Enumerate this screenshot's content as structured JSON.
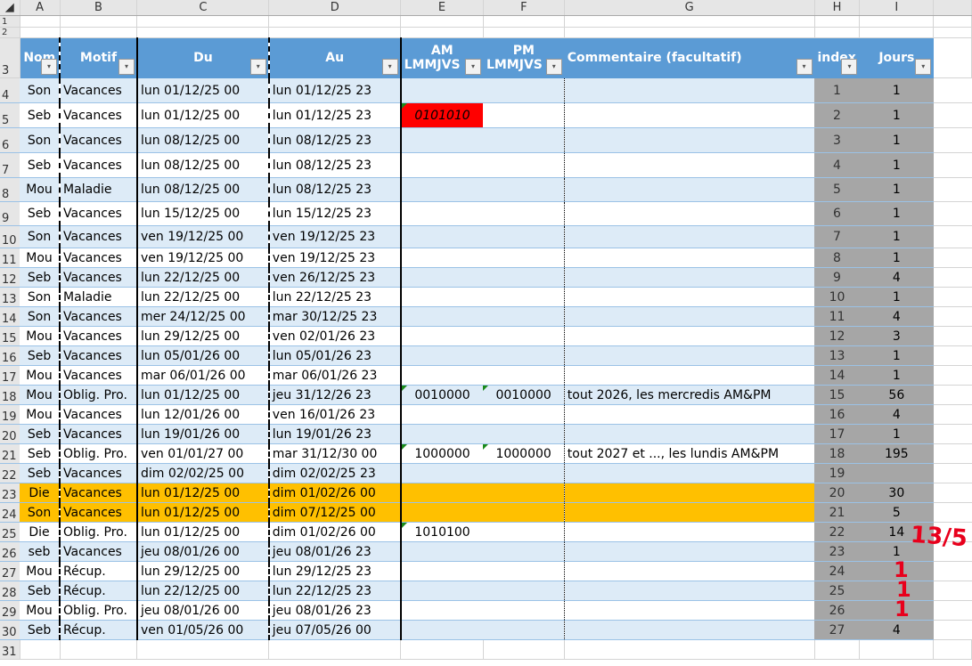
{
  "columns": [
    "A",
    "B",
    "C",
    "D",
    "E",
    "F",
    "G",
    "H",
    "I"
  ],
  "headers": {
    "nom": "Nom",
    "motif": "Motif",
    "du": "Du",
    "au": "Au",
    "am1": "AM",
    "am2": "LMMJVS",
    "pm1": "PM",
    "pm2": "LMMJVS",
    "commentaire": "Commentaire (facultatif)",
    "index": "index",
    "jours": "Jours"
  },
  "rows": [
    [
      "Son",
      "Vacances",
      "lun 01/12/25 00",
      "lun 01/12/25 23",
      "",
      "",
      "",
      "1",
      "1"
    ],
    [
      "Seb",
      "Vacances",
      "lun 01/12/25 00",
      "lun 01/12/25 23",
      "0101010",
      "",
      "",
      "2",
      "1"
    ],
    [
      "Son",
      "Vacances",
      "lun 08/12/25 00",
      "lun 08/12/25 23",
      "",
      "",
      "",
      "3",
      "1"
    ],
    [
      "Seb",
      "Vacances",
      "lun 08/12/25 00",
      "lun 08/12/25 23",
      "",
      "",
      "",
      "4",
      "1"
    ],
    [
      "Mou",
      "Maladie",
      "lun 08/12/25 00",
      "lun 08/12/25 23",
      "",
      "",
      "",
      "5",
      "1"
    ],
    [
      "Seb",
      "Vacances",
      "lun 15/12/25 00",
      "lun 15/12/25 23",
      "",
      "",
      "",
      "6",
      "1"
    ],
    [
      "Son",
      "Vacances",
      "ven 19/12/25 00",
      "ven 19/12/25 23",
      "",
      "",
      "",
      "7",
      "1"
    ],
    [
      "Mou",
      "Vacances",
      "ven 19/12/25 00",
      "ven 19/12/25 23",
      "",
      "",
      "",
      "8",
      "1"
    ],
    [
      "Seb",
      "Vacances",
      "lun 22/12/25 00",
      "ven 26/12/25 23",
      "",
      "",
      "",
      "9",
      "4"
    ],
    [
      "Son",
      "Maladie",
      "lun 22/12/25 00",
      "lun 22/12/25 23",
      "",
      "",
      "",
      "10",
      "1"
    ],
    [
      "Son",
      "Vacances",
      "mer 24/12/25 00",
      "mar 30/12/25 23",
      "",
      "",
      "",
      "11",
      "4"
    ],
    [
      "Mou",
      "Vacances",
      "lun 29/12/25 00",
      "ven 02/01/26 23",
      "",
      "",
      "",
      "12",
      "3"
    ],
    [
      "Seb",
      "Vacances",
      "lun 05/01/26 00",
      "lun 05/01/26 23",
      "",
      "",
      "",
      "13",
      "1"
    ],
    [
      "Mou",
      "Vacances",
      "mar 06/01/26 00",
      "mar 06/01/26 23",
      "",
      "",
      "",
      "14",
      "1"
    ],
    [
      "Mou",
      "Oblig. Pro.",
      "lun 01/12/25 00",
      "jeu 31/12/26 23",
      "0010000",
      "0010000",
      "tout 2026, les mercredis AM&PM",
      "15",
      "56"
    ],
    [
      "Mou",
      "Vacances",
      "lun 12/01/26 00",
      "ven 16/01/26 23",
      "",
      "",
      "",
      "16",
      "4"
    ],
    [
      "Seb",
      "Vacances",
      "lun 19/01/26 00",
      "lun 19/01/26 23",
      "",
      "",
      "",
      "17",
      "1"
    ],
    [
      "Seb",
      "Oblig. Pro.",
      "ven 01/01/27 00",
      "mar 31/12/30 00",
      "1000000",
      "1000000",
      "tout 2027 et ..., les lundis AM&PM",
      "18",
      "195"
    ],
    [
      "Seb",
      "Vacances",
      "dim 02/02/25 00",
      "dim 02/02/25 23",
      "",
      "",
      "",
      "19",
      ""
    ],
    [
      "Die",
      "Vacances",
      "lun 01/12/25 00",
      "dim 01/02/26 00",
      "",
      "",
      "",
      "20",
      "30"
    ],
    [
      "Son",
      "Vacances",
      "lun 01/12/25 00",
      "dim 07/12/25 00",
      "",
      "",
      "",
      "21",
      "5"
    ],
    [
      "Die",
      "Oblig. Pro.",
      "lun 01/12/25 00",
      "dim 01/02/26 00",
      "1010100",
      "",
      "",
      "22",
      "14"
    ],
    [
      "seb",
      "Vacances",
      "jeu 08/01/26 00",
      "jeu 08/01/26 23",
      "",
      "",
      "",
      "23",
      "1"
    ],
    [
      "Mou",
      "Récup.",
      "lun 29/12/25 00",
      "lun 29/12/25 23",
      "",
      "",
      "",
      "24",
      ""
    ],
    [
      "Seb",
      "Récup.",
      "lun 22/12/25 00",
      "lun 22/12/25 23",
      "",
      "",
      "",
      "25",
      ""
    ],
    [
      "Mou",
      "Oblig. Pro.",
      "jeu 08/01/26 00",
      "jeu 08/01/26 23",
      "",
      "",
      "",
      "26",
      ""
    ],
    [
      "Seb",
      "Récup.",
      "ven 01/05/26 00",
      "jeu 07/05/26 00",
      "",
      "",
      "",
      "27",
      "4"
    ]
  ],
  "annotations": {
    "main": "13/5",
    "ones": [
      "1",
      "1",
      "1"
    ]
  },
  "colors": {
    "header": "#5b9bd5",
    "band": "#ddebf7",
    "highlight": "#ffc000",
    "error": "#ff0000",
    "computed": "#a6a6a6",
    "annotation": "#e8001c"
  }
}
